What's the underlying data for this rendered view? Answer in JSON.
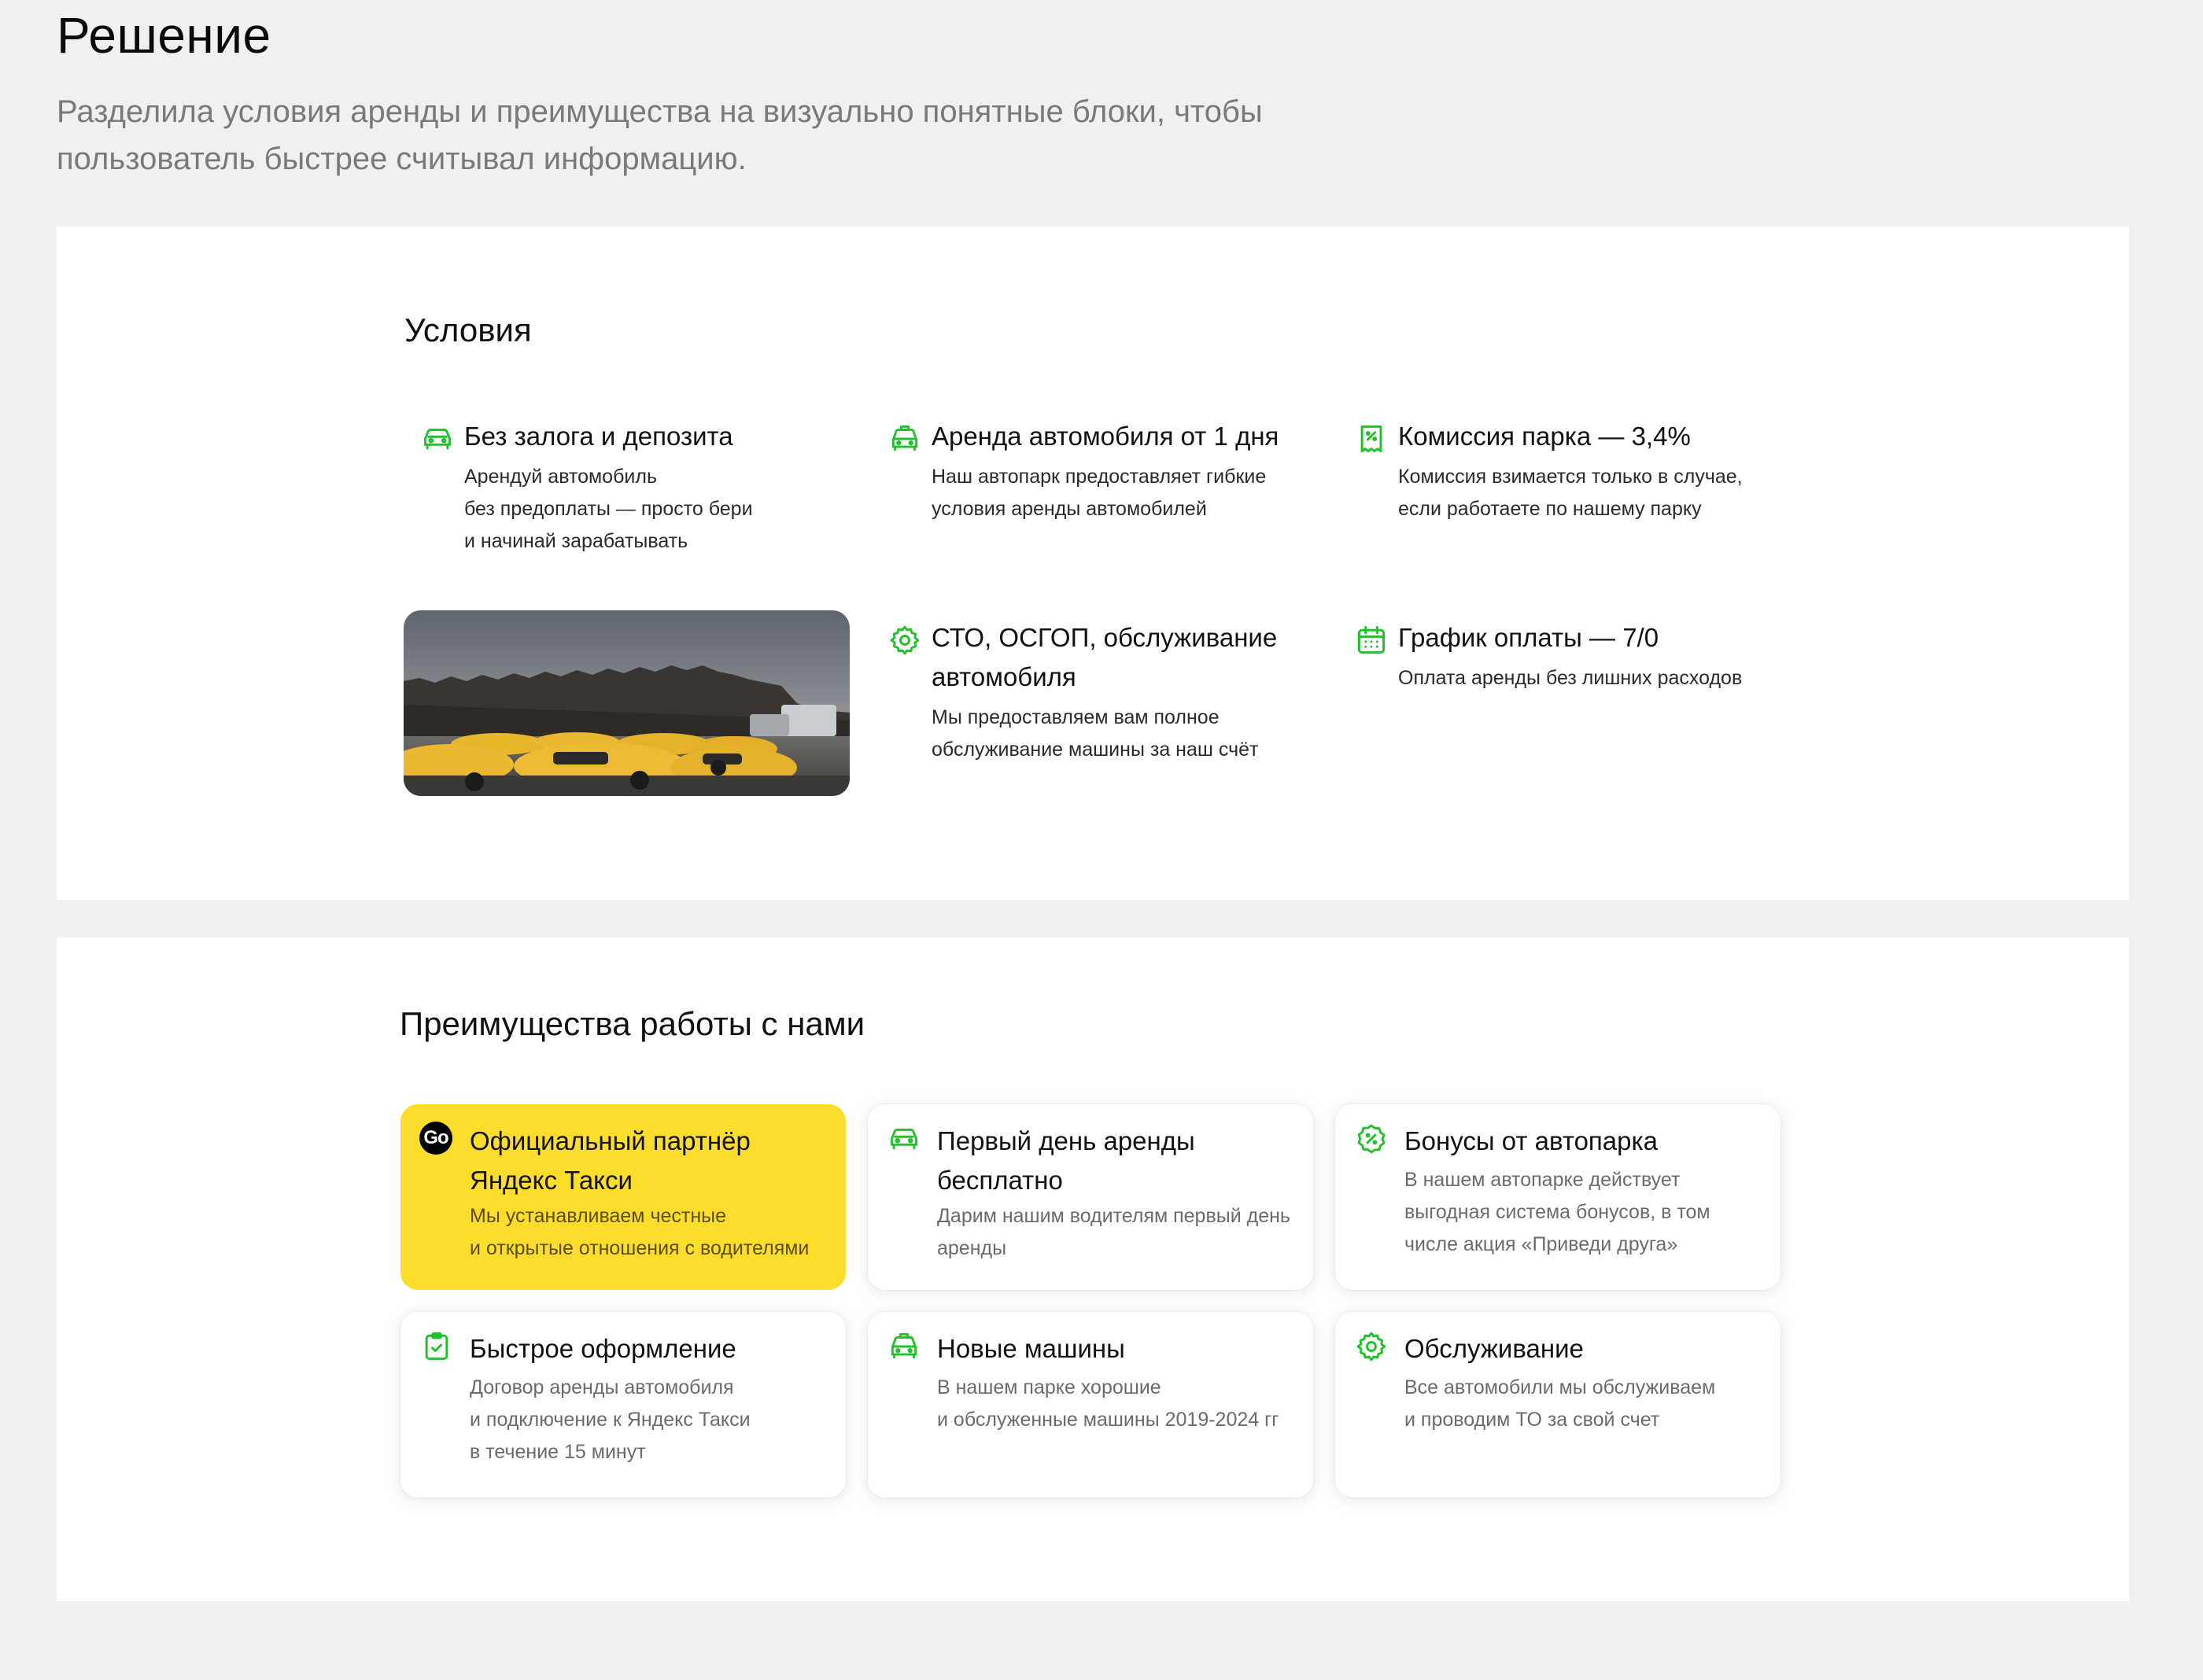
{
  "header": {
    "title": "Решение",
    "intro": "Разделила условия аренды и преимущества на визуально понятные блоки, чтобы пользователь быстрее считывал информацию."
  },
  "conditions": {
    "title": "Условия",
    "items": [
      {
        "icon": "car-icon",
        "title": "Без залога и депозита",
        "text": [
          "Арендуй автомобиль",
          "без предоплаты —  просто бери",
          "и начинай зарабатывать"
        ]
      },
      {
        "icon": "taxi-icon",
        "title": "Аренда автомобиля от 1 дня",
        "text": [
          "Наш автопарк предоставляет гибкие",
          "условия аренды автомобилей"
        ]
      },
      {
        "icon": "receipt-percent-icon",
        "title": "Комиссия парка — 3,4%",
        "text": [
          "Комиссия взимается только в случае,",
          "если работаете по нашему парку"
        ]
      },
      {
        "icon": "gear-icon",
        "title": "СТО, ОСГОП, обслуживание автомобиля",
        "text": [
          "Мы предоставляем вам полное",
          "обслуживание машины за наш счёт"
        ]
      },
      {
        "icon": "calendar-icon",
        "title": "График оплаты — 7/0",
        "text": [
          "Оплата аренды без лишних расходов"
        ]
      }
    ]
  },
  "advantages": {
    "title": "Преимущества работы с нами",
    "cards": [
      {
        "icon": "yandex-go-icon",
        "badge": "Go",
        "title": [
          "Официальный партнёр",
          "Яндекс Такси"
        ],
        "text": [
          "Мы устанавливаем честные",
          "и открытые отношения с водителями"
        ],
        "highlight": true,
        "color": "#fddd2b"
      },
      {
        "icon": "car-icon",
        "title": [
          "Первый день аренды",
          "бесплатно"
        ],
        "text": [
          "Дарим нашим водителям первый день",
          "аренды"
        ]
      },
      {
        "icon": "discount-badge-icon",
        "title": [
          "Бонусы от автопарка"
        ],
        "text": [
          "В нашем автопарке действует",
          "выгодная система бонусов, в том",
          "числе акция «Приведи друга»"
        ]
      },
      {
        "icon": "clipboard-check-icon",
        "title": [
          "Быстрое оформление"
        ],
        "text": [
          "Договор аренды автомобиля",
          "и подключение к Яндекс Такси",
          "в течение 15 минут"
        ]
      },
      {
        "icon": "taxi-icon",
        "title": [
          "Новые машины"
        ],
        "text": [
          "В нашем парке хорошие",
          "и обслуженные машины 2019-2024 гг"
        ]
      },
      {
        "icon": "gear-icon",
        "title": [
          "Обслуживание"
        ],
        "text": [
          "Все автомобили мы обслуживаем",
          "и проводим ТО за свой счет"
        ]
      }
    ]
  },
  "colors": {
    "accent_green": "#22c02a",
    "yandex_yellow": "#fddd2b",
    "page_bg": "#f0f0f0"
  }
}
